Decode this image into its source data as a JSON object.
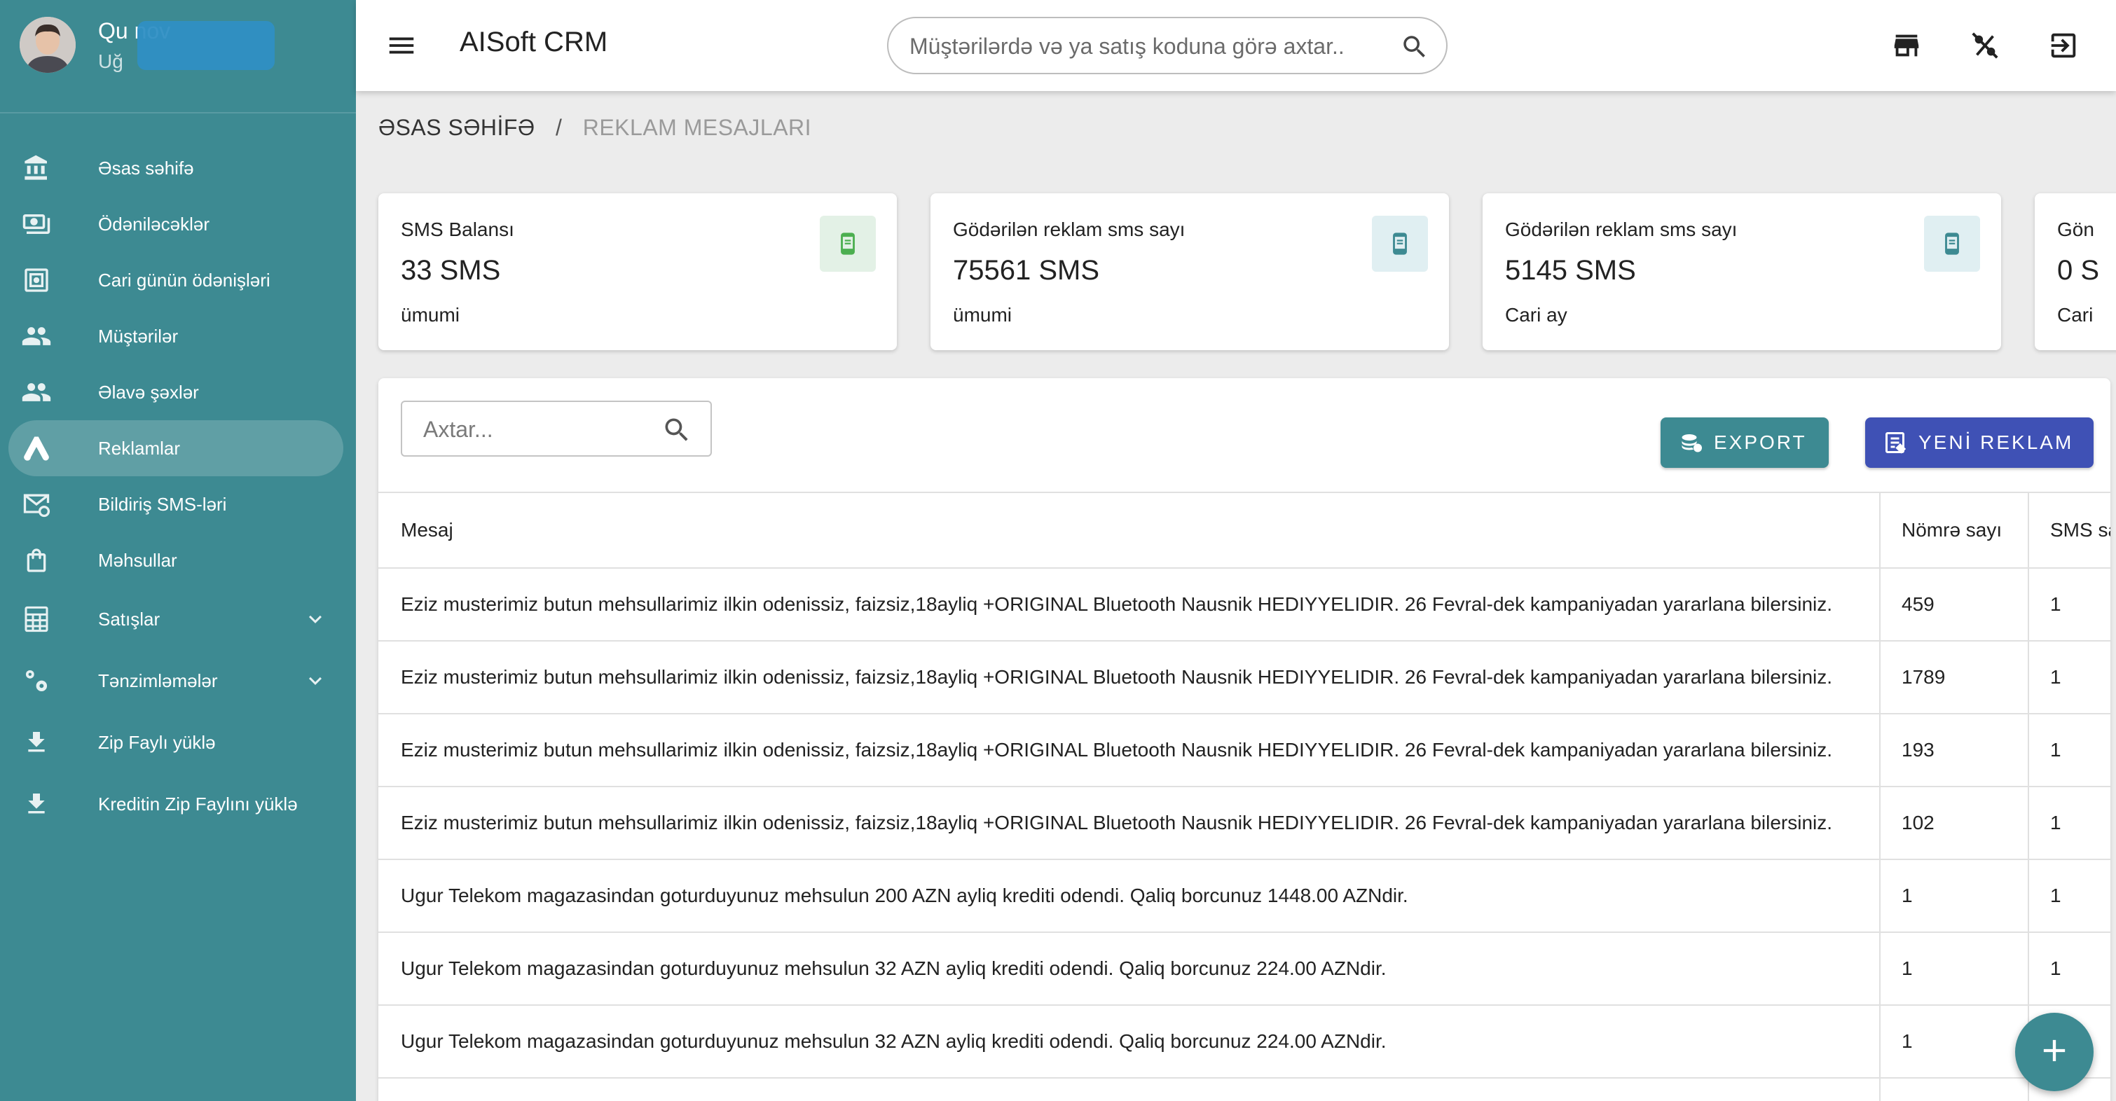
{
  "sidebar": {
    "user_name": "Qu            nov",
    "user_sub": "Uğ",
    "items": [
      {
        "label": "Əsas səhifə",
        "icon": "bank-icon"
      },
      {
        "label": "Ödəniləcəklər",
        "icon": "cash-icon"
      },
      {
        "label": "Cari günün ödənişləri",
        "icon": "safe-icon"
      },
      {
        "label": "Müştərilər",
        "icon": "people-icon"
      },
      {
        "label": "Əlavə şəxlər",
        "icon": "people-icon"
      },
      {
        "label": "Reklamlar",
        "icon": "ads-icon"
      },
      {
        "label": "Bildiriş SMS-ləri",
        "icon": "mail-sync-icon"
      },
      {
        "label": "Məhsullar",
        "icon": "shopping-bag-icon"
      },
      {
        "label": "Satışlar",
        "icon": "spreadsheet-icon"
      },
      {
        "label": "Tənzimləmələr",
        "icon": "settings-icon"
      },
      {
        "label": "Zip Faylı yüklə",
        "icon": "download-icon"
      },
      {
        "label": "Kreditin Zip Faylını yüklə",
        "icon": "download-icon"
      }
    ]
  },
  "header": {
    "title": "AISoft CRM",
    "search_placeholder": "Müştərilərdə və ya satış koduna görə axtar.."
  },
  "breadcrumb": {
    "home": "ƏSAS SƏHİFƏ",
    "separator": "/",
    "current": "REKLAM MESAJLARI"
  },
  "cards": [
    {
      "title": "SMS Balansı",
      "value": "33 SMS",
      "sub": "ümumi",
      "icon_bg": "#e3f1e6",
      "icon_color": "#4caf50"
    },
    {
      "title": "Gödərilən reklam sms sayı",
      "value": "75561 SMS",
      "sub": "ümumi",
      "icon_bg": "#e0eff2",
      "icon_color": "#3d8a92"
    },
    {
      "title": "Gödərilən reklam sms sayı",
      "value": "5145 SMS",
      "sub": "Cari ay",
      "icon_bg": "#e0eff2",
      "icon_color": "#3d8a92"
    },
    {
      "title": "Gön",
      "value": "0 S",
      "sub": "Cari",
      "icon_bg": "#e0eff2",
      "icon_color": "#3d8a92"
    }
  ],
  "table": {
    "search_placeholder": "Axtar...",
    "export_label": "EXPORT",
    "new_label": "YENİ REKLAM",
    "columns": [
      "Mesaj",
      "Nömrə sayı",
      "SMS sa"
    ],
    "rows": [
      [
        "Eziz musterimiz butun mehsullarimiz ilkin odenissiz, faizsiz,18ayliq +ORIGINAL Bluetooth Nausnik HEDIYYELIDIR. 26 Fevral-dek kampaniyadan yararlana bilersiniz.",
        "459",
        "1"
      ],
      [
        "Eziz musterimiz butun mehsullarimiz ilkin odenissiz, faizsiz,18ayliq +ORIGINAL Bluetooth Nausnik HEDIYYELIDIR. 26 Fevral-dek kampaniyadan yararlana bilersiniz.",
        "1789",
        "1"
      ],
      [
        "Eziz musterimiz butun mehsullarimiz ilkin odenissiz, faizsiz,18ayliq +ORIGINAL Bluetooth Nausnik HEDIYYELIDIR. 26 Fevral-dek kampaniyadan yararlana bilersiniz.",
        "193",
        "1"
      ],
      [
        "Eziz musterimiz butun mehsullarimiz ilkin odenissiz, faizsiz,18ayliq +ORIGINAL Bluetooth Nausnik HEDIYYELIDIR. 26 Fevral-dek kampaniyadan yararlana bilersiniz.",
        "102",
        "1"
      ],
      [
        "Ugur Telekom magazasindan goturduyunuz mehsulun 200 AZN ayliq krediti odendi. Qaliq borcunuz 1448.00 AZNdir.",
        "1",
        "1"
      ],
      [
        "Ugur Telekom magazasindan goturduyunuz mehsulun 32 AZN ayliq krediti odendi. Qaliq borcunuz 224.00 AZNdir.",
        "1",
        "1"
      ],
      [
        "Ugur Telekom magazasindan goturduyunuz mehsulun 32 AZN ayliq krediti odendi. Qaliq borcunuz 224.00 AZNdir.",
        "1",
        ""
      ]
    ]
  },
  "colors": {
    "sidebar": "#3d8a92",
    "accent_export": "#3d8a92",
    "accent_new": "#3f51b5"
  }
}
